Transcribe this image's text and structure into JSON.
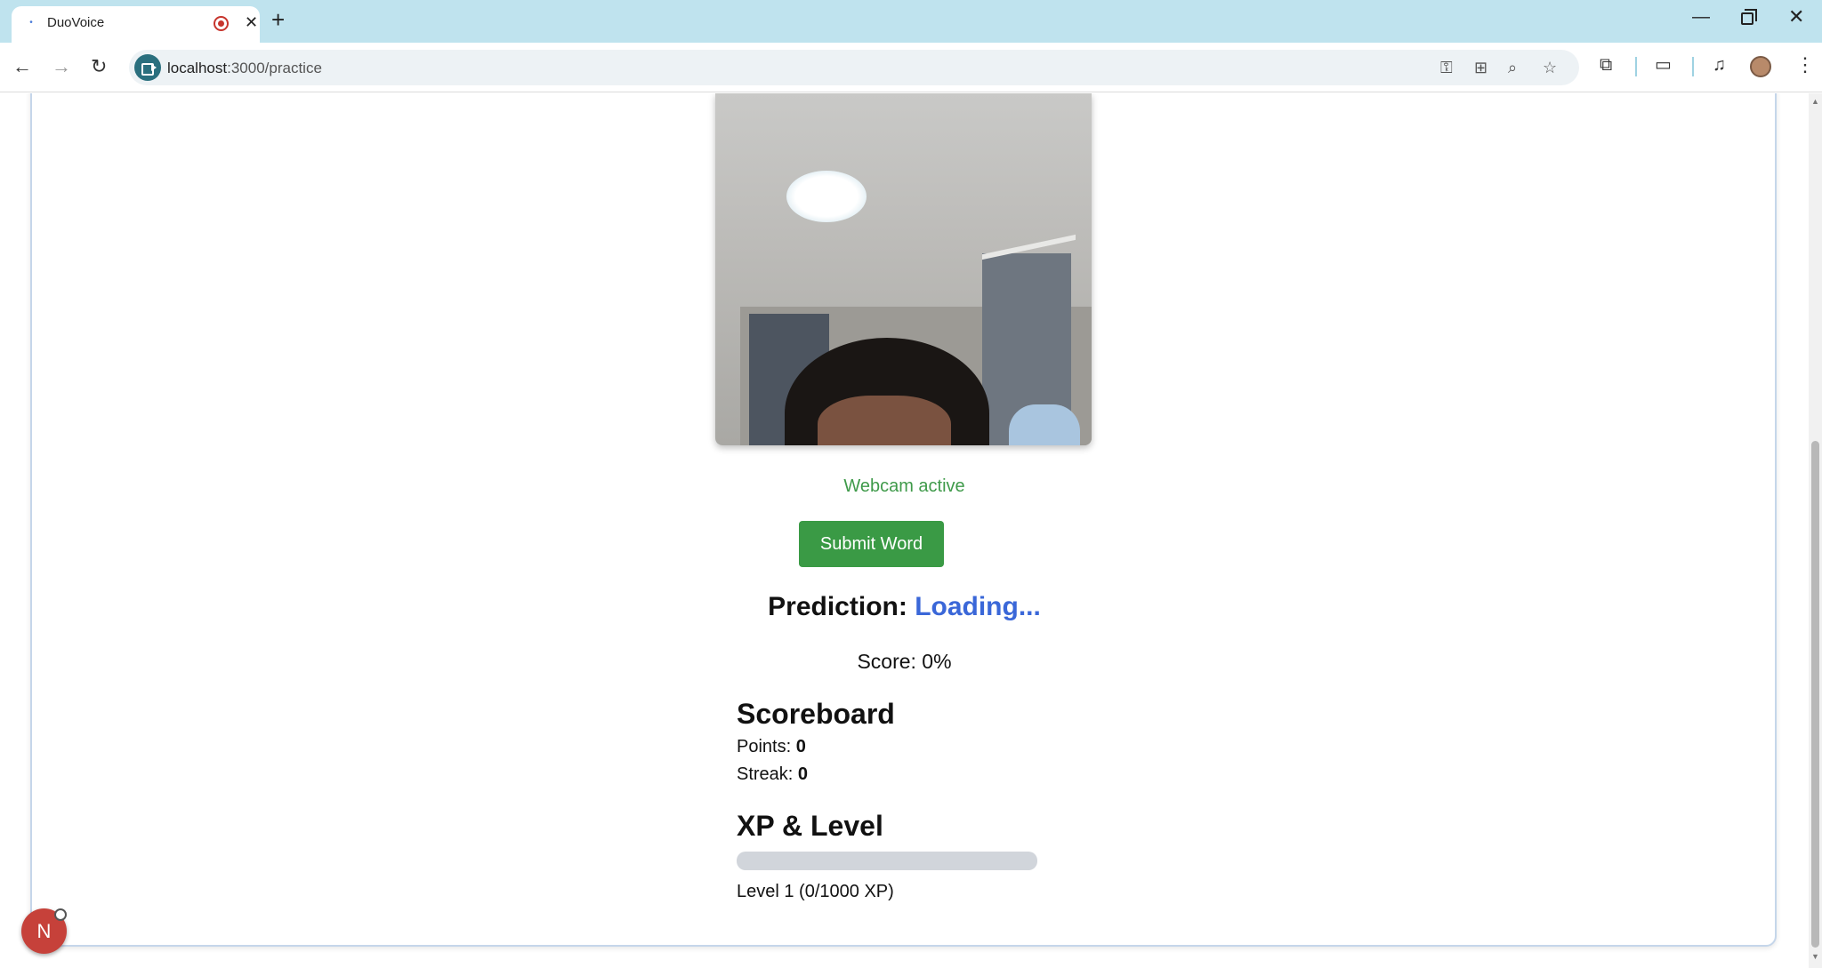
{
  "browser": {
    "tab_title": "DuoVoice",
    "tab_close": "✕",
    "new_tab": "+",
    "url_host": "localhost",
    "url_path": ":3000/practice",
    "window": {
      "minimize": "—",
      "close": "✕"
    },
    "nav": {
      "back": "←",
      "forward": "→",
      "reload": "↻"
    },
    "menu": "⋮"
  },
  "practice": {
    "webcam_status": "Webcam active",
    "submit_label": "Submit Word",
    "prediction_label": "Prediction:",
    "prediction_value": "Loading...",
    "score_text": "Score: 0%",
    "colors": {
      "accent": "#3a9a45",
      "prediction": "#3a67d8",
      "status": "#3f9a4a"
    }
  },
  "scoreboard": {
    "title": "Scoreboard",
    "points_label": "Points:",
    "points_value": "0",
    "streak_label": "Streak:",
    "streak_value": "0"
  },
  "xp": {
    "title": "XP & Level",
    "progress": 0,
    "level_text": "Level 1 (0/1000 XP)"
  },
  "fab": {
    "letter": "N"
  }
}
